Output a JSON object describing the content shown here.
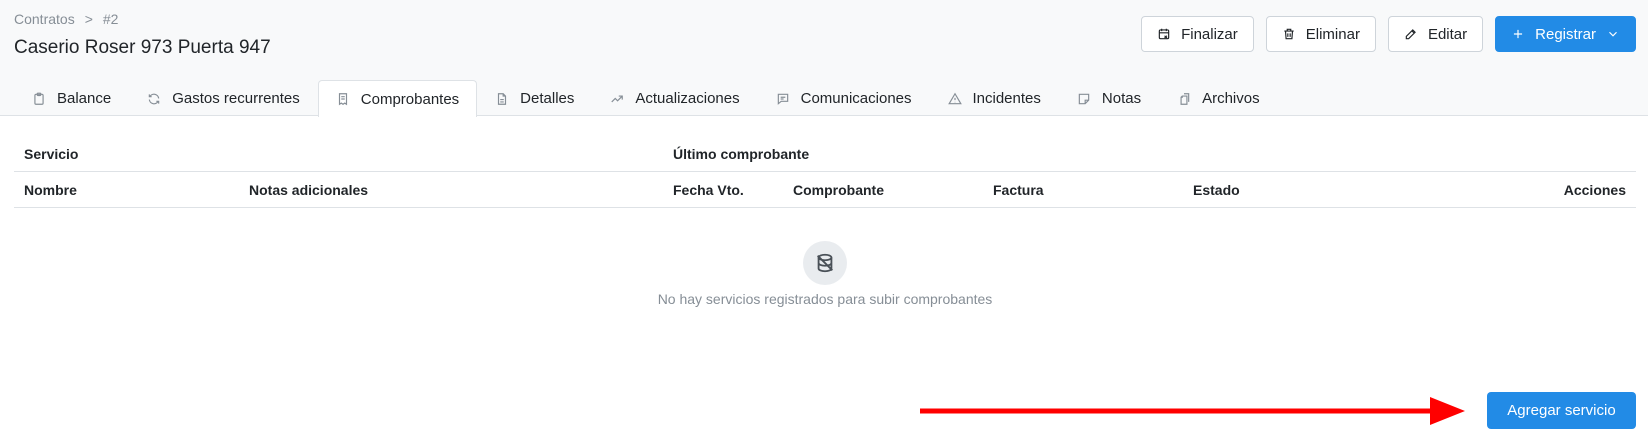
{
  "breadcrumb": {
    "items": [
      "Contratos",
      "#2"
    ],
    "separator": ">"
  },
  "page": {
    "title": "Caserio Roser 973 Puerta 947"
  },
  "actions": {
    "finalizar": "Finalizar",
    "eliminar": "Eliminar",
    "editar": "Editar",
    "registrar": "Registrar"
  },
  "tabs": [
    {
      "label": "Balance",
      "icon": "clipboard-icon"
    },
    {
      "label": "Gastos recurrentes",
      "icon": "refresh-icon"
    },
    {
      "label": "Comprobantes",
      "icon": "receipt-icon",
      "active": true
    },
    {
      "label": "Detalles",
      "icon": "file-text-icon"
    },
    {
      "label": "Actualizaciones",
      "icon": "trending-up-icon"
    },
    {
      "label": "Comunicaciones",
      "icon": "message-icon"
    },
    {
      "label": "Incidentes",
      "icon": "alert-triangle-icon"
    },
    {
      "label": "Notas",
      "icon": "note-icon"
    },
    {
      "label": "Archivos",
      "icon": "files-icon"
    }
  ],
  "table": {
    "group_headers": {
      "servicio": "Servicio",
      "ultimo": "Último comprobante"
    },
    "columns": {
      "nombre": "Nombre",
      "notas": "Notas adicionales",
      "fecha": "Fecha Vto.",
      "comprobante": "Comprobante",
      "factura": "Factura",
      "estado": "Estado",
      "acciones": "Acciones"
    },
    "rows": []
  },
  "empty_state": {
    "icon": "database-off-icon",
    "message": "No hay servicios registrados para subir comprobantes"
  },
  "footer": {
    "add_service": "Agregar servicio"
  },
  "colors": {
    "primary": "#228be6",
    "arrow": "#ff0000"
  }
}
